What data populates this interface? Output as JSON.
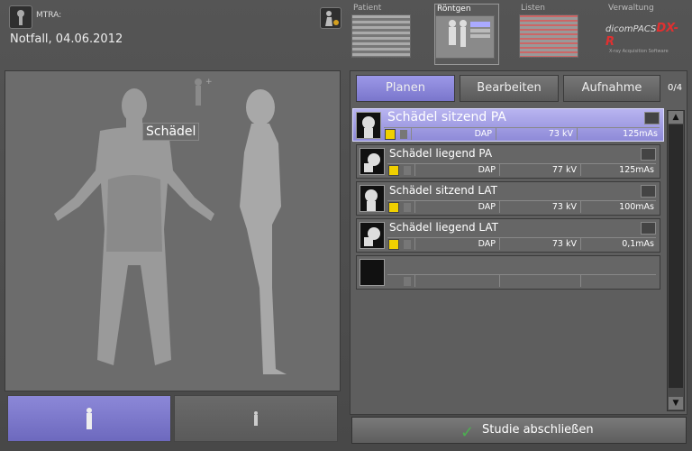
{
  "header": {
    "mtra_label": "MTRA:",
    "case_info": "Notfall,  04.06.2012"
  },
  "nav_tabs": [
    {
      "label": "Patient"
    },
    {
      "label": "Röntgen"
    },
    {
      "label": "Listen"
    },
    {
      "label": "Verwaltung"
    }
  ],
  "brand": {
    "logo_text": "dicomPACS",
    "logo_suffix": "DX-R",
    "subtitle": "X-ray Acquisition Software"
  },
  "body_map": {
    "selected_region": "Schädel"
  },
  "actions": {
    "planen": "Planen",
    "bearbeiten": "Bearbeiten",
    "aufnahme": "Aufnahme",
    "counter": "0/4"
  },
  "exposures": [
    {
      "name": "Schädel sitzend PA",
      "dap": "DAP",
      "kv": "73 kV",
      "mas": "125mAs",
      "selected": true
    },
    {
      "name": "Schädel liegend PA",
      "dap": "DAP",
      "kv": "77 kV",
      "mas": "125mAs",
      "selected": false
    },
    {
      "name": "Schädel sitzend LAT",
      "dap": "DAP",
      "kv": "73 kV",
      "mas": "100mAs",
      "selected": false
    },
    {
      "name": "Schädel liegend LAT",
      "dap": "DAP",
      "kv": "73 kV",
      "mas": "0,1mAs",
      "selected": false
    }
  ],
  "finish_button": "Studie abschließen",
  "colors": {
    "accent": "#8a86d8",
    "panel": "#6c6c6c",
    "radiation": "#f0d000"
  }
}
